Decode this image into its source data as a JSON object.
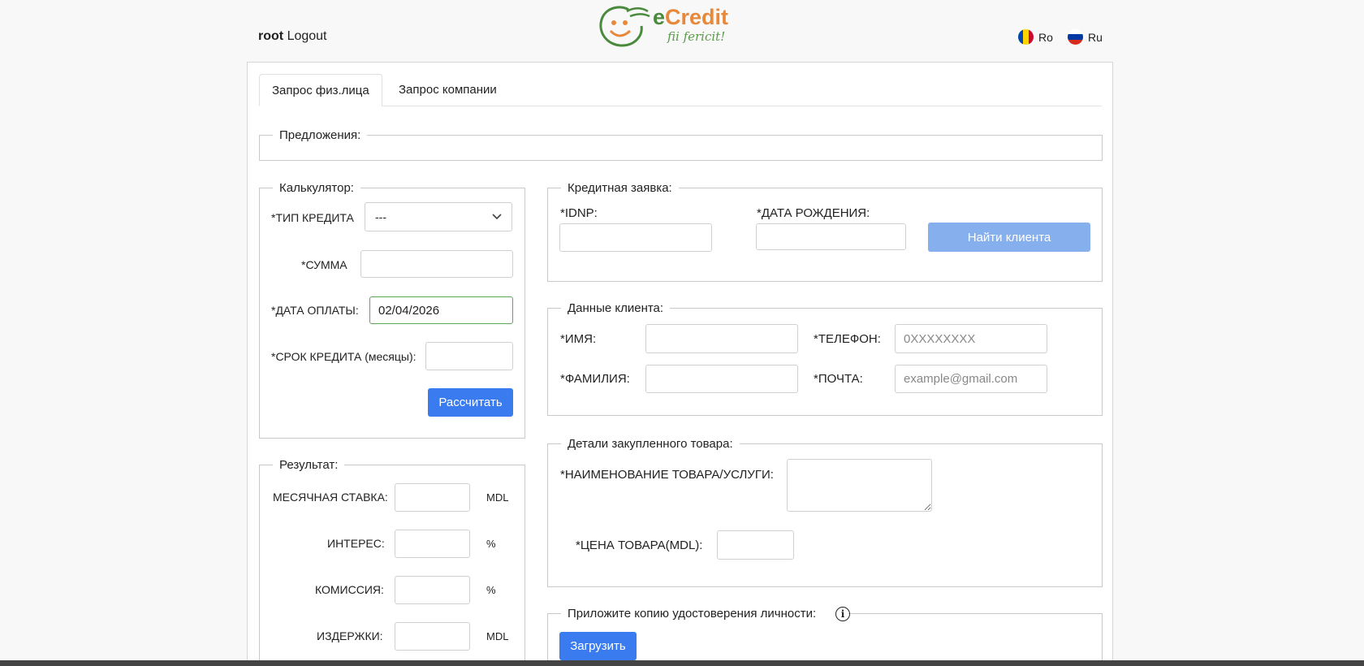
{
  "header": {
    "user_name": "root",
    "logout_label": "Logout",
    "logo_brand_e": "e",
    "logo_brand_rest": "Credit",
    "logo_slogan": "fii fericit!",
    "lang_ro": "Ro",
    "lang_ru": "Ru"
  },
  "tabs": [
    "Запрос физ.лица",
    "Запрос компании"
  ],
  "offers": {
    "legend": "Предложения:"
  },
  "calculator": {
    "legend": "Калькулятор:",
    "credit_type_label": "*ТИП КРЕДИТА",
    "credit_type_value": "---",
    "amount_label": "*СУММА",
    "payment_date_label": "*ДАТА ОПЛАТЫ:",
    "payment_date_value": "02/04/2026",
    "term_label": "*СРОК КРЕДИТА (месяцы):",
    "calculate_button": "Рассчитать"
  },
  "result": {
    "legend": "Результат:",
    "monthly_rate_label": "МЕСЯЧНАЯ СТАВКА:",
    "monthly_rate_unit": "MDL",
    "interest_label": "ИНТЕРЕС:",
    "interest_unit": "%",
    "commission_label": "КОМИССИЯ:",
    "commission_unit": "%",
    "costs_label": "ИЗДЕРЖКИ:",
    "costs_unit": "MDL"
  },
  "credit_request": {
    "legend": "Кредитная заявка:",
    "idnp_label": "*IDNP:",
    "birth_date_label": "*ДАТА РОЖДЕНИЯ:",
    "find_client_button": "Найти клиента"
  },
  "client_data": {
    "legend": "Данные клиента:",
    "first_name_label": "*ИМЯ:",
    "phone_label": "*ТЕЛЕФОН:",
    "phone_placeholder": "0XXXXXXXX",
    "last_name_label": "*ФАМИЛИЯ:",
    "email_label": "*ПОЧТА:",
    "email_placeholder": "example@gmail.com"
  },
  "product_details": {
    "legend": "Детали закупленного товара:",
    "product_name_label": "*НАИМЕНОВАНИЕ ТОВАРА/УСЛУГИ:",
    "price_label": "*ЦЕНА ТОВАРА(MDL):"
  },
  "id_copy": {
    "legend": "Приложите копию удостоверения личности:",
    "info_icon": "info-icon",
    "upload_button": "Загрузить"
  },
  "colors": {
    "primary": "#3a7bf0",
    "primary_disabled": "#86afed",
    "focus_border": "#5aa85a",
    "logo_orange": "#e8883a",
    "logo_green": "#4a8a3c"
  }
}
